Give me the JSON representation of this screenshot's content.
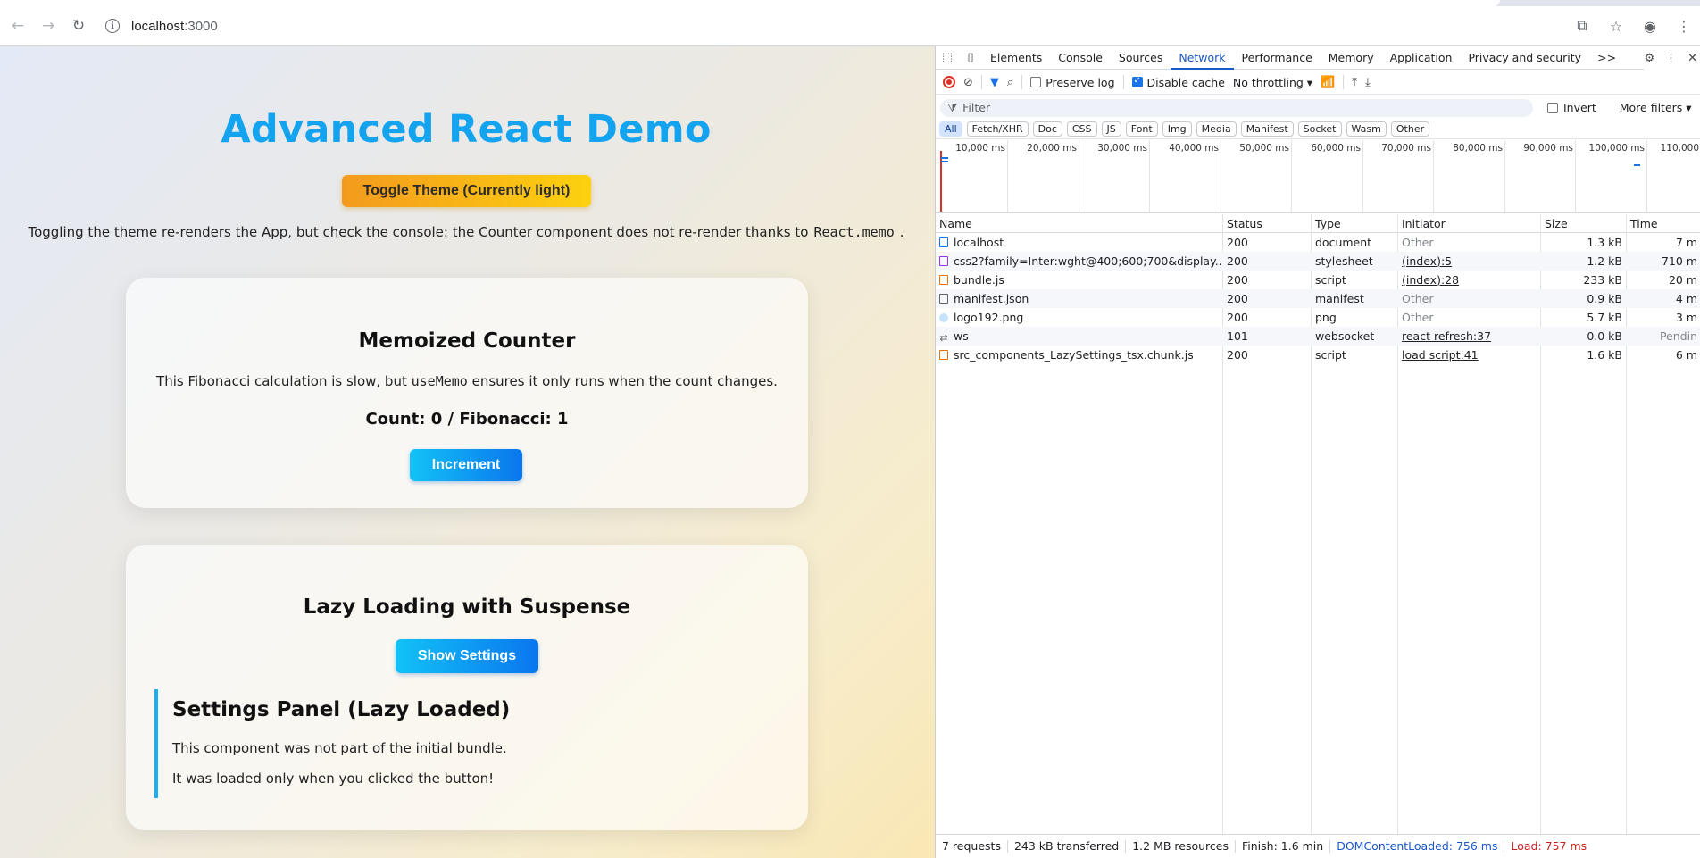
{
  "browser": {
    "url_host": "localhost",
    "url_port": ":3000"
  },
  "app": {
    "title": "Advanced React Demo",
    "theme_button": "Toggle Theme (Currently light)",
    "intro_text": "Toggling the theme re-renders the App, but check the console: the Counter component does not re-render thanks to",
    "intro_code": "React.memo",
    "intro_end": ".",
    "counter_card": {
      "title": "Memoized Counter",
      "desc_before": "This Fibonacci calculation is slow, but",
      "desc_code": "useMemo",
      "desc_after": "ensures it only runs when the count changes.",
      "count_text": "Count: 0 / Fibonacci: 1",
      "button": "Increment"
    },
    "lazy_card": {
      "title": "Lazy Loading with Suspense",
      "button": "Show Settings",
      "panel_title": "Settings Panel (Lazy Loaded)",
      "panel_p1": "This component was not part of the initial bundle.",
      "panel_p2": "It was loaded only when you clicked the button!"
    }
  },
  "devtools": {
    "tabs": [
      "Elements",
      "Console",
      "Sources",
      "Network",
      "Performance",
      "Memory",
      "Application",
      "Privacy and security"
    ],
    "active_tab": "Network",
    "overflow": ">>",
    "preserve_log": "Preserve log",
    "disable_cache": "Disable cache",
    "throttling": "No throttling",
    "filter_placeholder": "Filter",
    "invert": "Invert",
    "more_filters": "More filters",
    "type_filters": [
      "All",
      "Fetch/XHR",
      "Doc",
      "CSS",
      "JS",
      "Font",
      "Img",
      "Media",
      "Manifest",
      "Socket",
      "Wasm",
      "Other"
    ],
    "timeline_labels": [
      "10,000 ms",
      "20,000 ms",
      "30,000 ms",
      "40,000 ms",
      "50,000 ms",
      "60,000 ms",
      "70,000 ms",
      "80,000 ms",
      "90,000 ms",
      "100,000 ms",
      "110,000"
    ],
    "columns": [
      "Name",
      "Status",
      "Type",
      "Initiator",
      "Size",
      "Time"
    ],
    "requests": [
      {
        "name": "localhost",
        "icon": "doc",
        "status": "200",
        "type": "document",
        "initiator": "Other",
        "initiator_link": false,
        "size": "1.3 kB",
        "time": "7 m"
      },
      {
        "name": "css2?family=Inter:wght@400;600;700&display...",
        "icon": "css",
        "status": "200",
        "type": "stylesheet",
        "initiator": "(index):5",
        "initiator_link": true,
        "size": "1.2 kB",
        "time": "710 m"
      },
      {
        "name": "bundle.js",
        "icon": "js",
        "status": "200",
        "type": "script",
        "initiator": "(index):28",
        "initiator_link": true,
        "size": "233 kB",
        "time": "20 m"
      },
      {
        "name": "manifest.json",
        "icon": "man",
        "status": "200",
        "type": "manifest",
        "initiator": "Other",
        "initiator_link": false,
        "size": "0.9 kB",
        "time": "4 m"
      },
      {
        "name": "logo192.png",
        "icon": "img",
        "status": "200",
        "type": "png",
        "initiator": "Other",
        "initiator_link": false,
        "size": "5.7 kB",
        "time": "3 m"
      },
      {
        "name": "ws",
        "icon": "ws",
        "status": "101",
        "type": "websocket",
        "initiator": "react refresh:37",
        "initiator_link": true,
        "size": "0.0 kB",
        "time": "Pendin"
      },
      {
        "name": "src_components_LazySettings_tsx.chunk.js",
        "icon": "js",
        "status": "200",
        "type": "script",
        "initiator": "load script:41",
        "initiator_link": true,
        "size": "1.6 kB",
        "time": "6 m"
      }
    ],
    "summary": {
      "requests": "7 requests",
      "transferred": "243 kB transferred",
      "resources": "1.2 MB resources",
      "finish": "Finish: 1.6 min",
      "dom_content_loaded": "DOMContentLoaded: 756 ms",
      "load": "Load: 757 ms"
    }
  }
}
